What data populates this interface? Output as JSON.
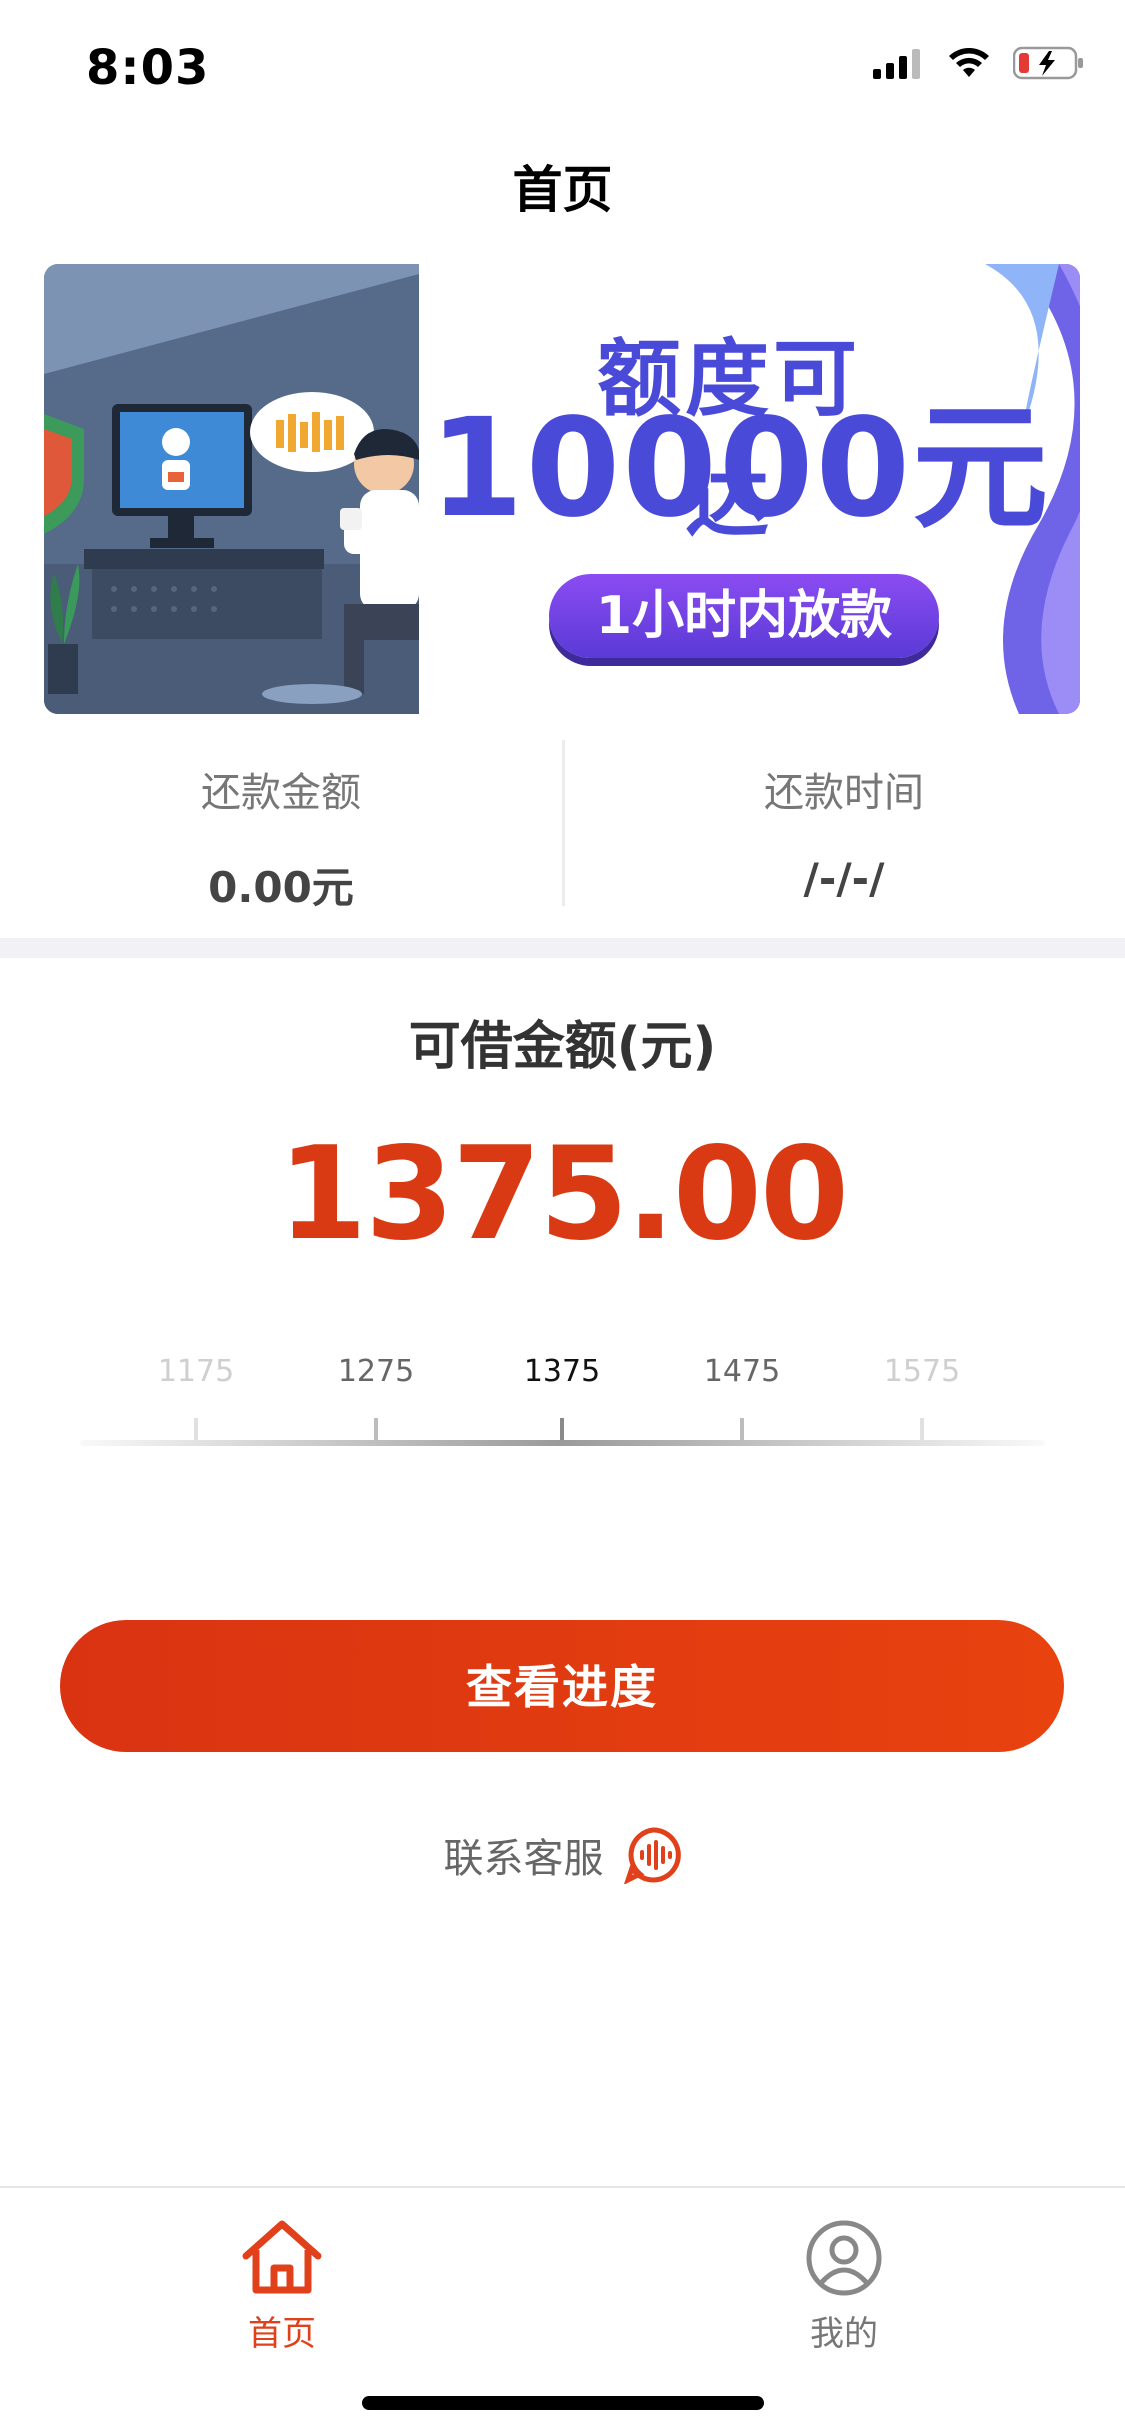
{
  "status_bar": {
    "time": "8:03",
    "icons": [
      "signal-icon",
      "wifi-icon",
      "battery-charging-icon"
    ]
  },
  "nav": {
    "title": "首页"
  },
  "banner": {
    "headline": "额度可达",
    "amount": "10000元",
    "badge": "1小时内放款",
    "colors": {
      "headline": "#4a4ad8",
      "badge": "#6a3ee0",
      "accent": "#7a6cf0"
    }
  },
  "repayment": {
    "amount_label": "还款金额",
    "amount_value": "0.00元",
    "date_label": "还款时间",
    "date_value": "/-/-/"
  },
  "borrow": {
    "title": "可借金额(元)",
    "amount": "1375.00",
    "amount_color": "#d93a14",
    "scale": {
      "ticks": [
        "1175",
        "1275",
        "1375",
        "1475",
        "1575"
      ],
      "selected": "1375"
    }
  },
  "actions": {
    "primary_button": "查看进度",
    "primary_color": "#e03c12",
    "contact_label": "联系客服",
    "contact_icon": "voice-chat-icon"
  },
  "tab_bar": {
    "items": [
      {
        "label": "首页",
        "icon": "home-icon",
        "active": true
      },
      {
        "label": "我的",
        "icon": "user-icon",
        "active": false
      }
    ],
    "active_color": "#e0401a",
    "inactive_color": "#777777"
  }
}
